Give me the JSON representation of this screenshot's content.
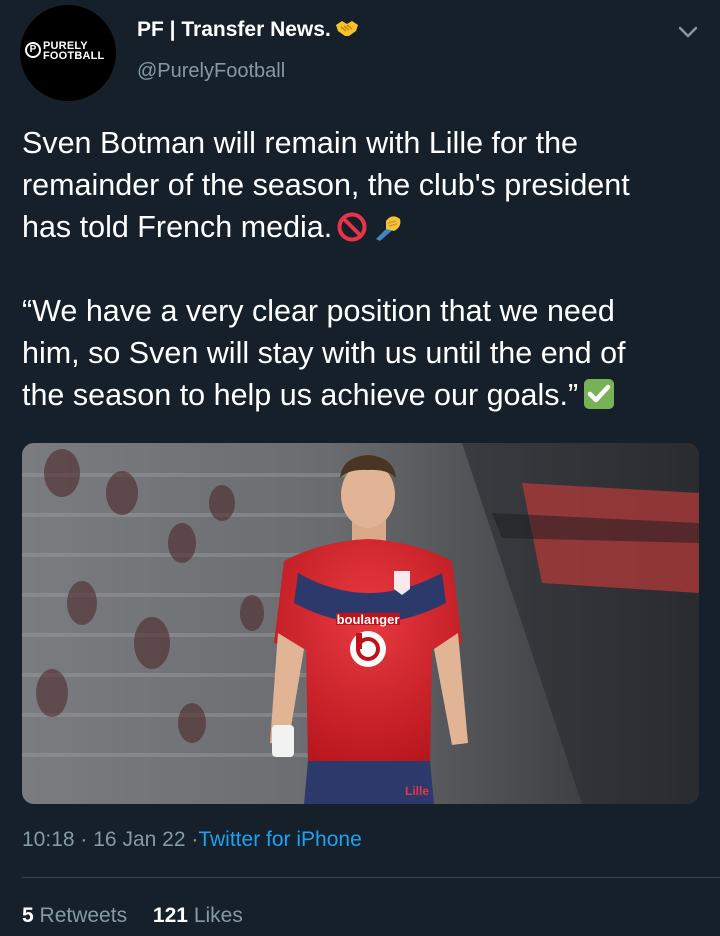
{
  "author": {
    "display_name": "PF | Transfer News.",
    "handle": "@PurelyFootball",
    "avatar_line1": "PURELY",
    "avatar_line2": "FOOTBALL",
    "avatar_mark": "P"
  },
  "tweet": {
    "lines": [
      "Sven Botman will remain with Lille for the",
      "remainder of the season, the club's president",
      "has told French media.",
      "“We have a very clear position that we need",
      "him, so Sven will stay with us until the end of",
      "the season to help us achieve our goals.”"
    ],
    "emojis": [
      "no-entry-sign",
      "writing-hand",
      "check-mark-button"
    ]
  },
  "media": {
    "jersey_brand": "boulanger",
    "shorts_text": "Lille"
  },
  "meta": {
    "time": "10:18",
    "separator": "·",
    "date": "16 Jan 22",
    "source": "Twitter for iPhone"
  },
  "stats": {
    "retweets_count": "5",
    "retweets_label": "Retweets",
    "likes_count": "121",
    "likes_label": "Likes"
  },
  "colors": {
    "background": "#15202b",
    "text": "#ffffff",
    "secondary": "#8899a6",
    "link": "#1da1f2",
    "divider": "#38444d"
  }
}
